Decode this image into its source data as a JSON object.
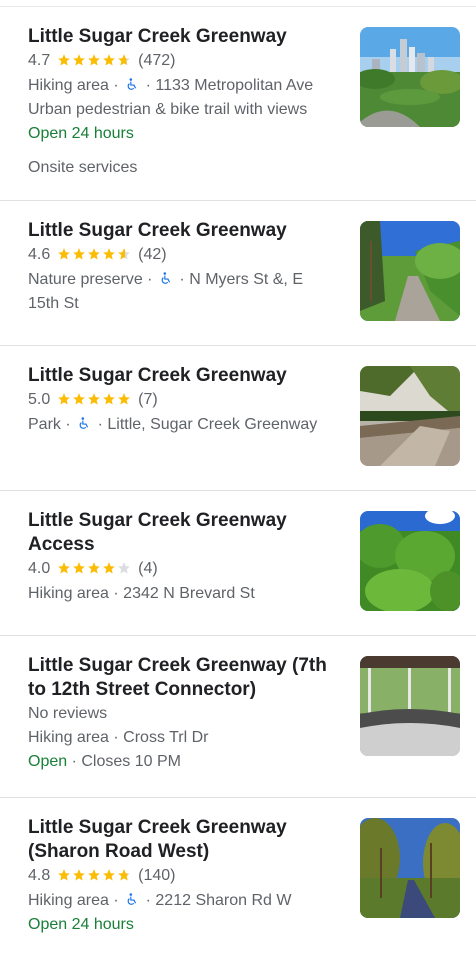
{
  "results": [
    {
      "title": "Little Sugar Creek Greenway",
      "rating": "4.7",
      "stars": 4.7,
      "reviews": "(472)",
      "category": "Hiking area",
      "accessible": true,
      "address": "1133 Metropolitan Ave",
      "description": "Urban pedestrian & bike trail with views",
      "hours": "Open 24 hours",
      "extra": "Onsite services",
      "thumb": "city-skyline-park"
    },
    {
      "title": "Little Sugar Creek Greenway",
      "rating": "4.6",
      "stars": 4.6,
      "reviews": "(42)",
      "category": "Nature preserve",
      "accessible": true,
      "address_line1": "N Myers St &, E",
      "address_line2": "15th St",
      "thumb": "wooded-trail"
    },
    {
      "title": "Little Sugar Creek Greenway",
      "rating": "5.0",
      "stars": 5.0,
      "reviews": "(7)",
      "category": "Park",
      "accessible": true,
      "address": "Little, Sugar Creek Greenway",
      "thumb": "palm-bridge"
    },
    {
      "title_line1": "Little Sugar Creek Greenway",
      "title_line2": "Access",
      "rating": "4.0",
      "stars": 4.0,
      "reviews": "(4)",
      "category": "Hiking area",
      "address": "2342 N Brevard St",
      "thumb": "green-trees"
    },
    {
      "title_line1": "Little Sugar Creek Greenway (7th",
      "title_line2": "to 12th Street Connector)",
      "no_reviews": "No reviews",
      "category": "Hiking area",
      "address": "Cross Trl Dr",
      "status": "Open",
      "closes": "Closes 10 PM",
      "thumb": "gazebo"
    },
    {
      "title_line1": "Little Sugar Creek Greenway",
      "title_line2": "(Sharon Road West)",
      "rating": "4.8",
      "stars": 4.8,
      "reviews": "(140)",
      "category": "Hiking area",
      "accessible": true,
      "address": "2212 Sharon Rd W",
      "hours": "Open 24 hours",
      "thumb": "forest-path"
    }
  ],
  "separator": "·",
  "colors": {
    "star": "#fbbc04",
    "star_empty": "#dadce0",
    "open": "#188038",
    "accessible": "#1a73e8"
  }
}
